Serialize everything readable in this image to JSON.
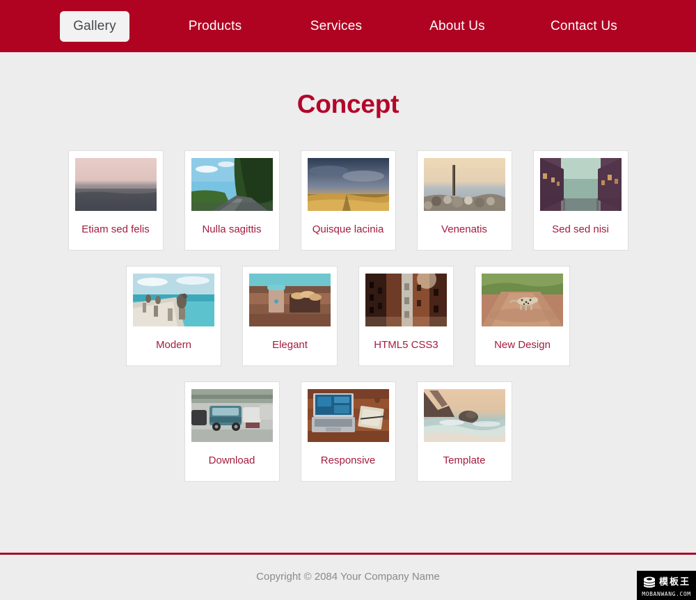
{
  "nav": {
    "items": [
      {
        "label": "Gallery",
        "active": true
      },
      {
        "label": "Products",
        "active": false
      },
      {
        "label": "Services",
        "active": false
      },
      {
        "label": "About Us",
        "active": false
      },
      {
        "label": "Contact Us",
        "active": false
      }
    ],
    "background_color": "#b00322",
    "active_background_color": "#f2f2f2",
    "active_text_color": "#444a4d",
    "text_color": "#ffffff"
  },
  "main": {
    "title": "Concept",
    "title_color": "#b3062a",
    "background_color": "#ededed",
    "gallery": {
      "label_color": "#a31c3e",
      "rows": [
        {
          "items": [
            {
              "label": "Etiam sed felis",
              "image": "seascape-pink-horizon"
            },
            {
              "label": "Nulla sagittis",
              "image": "coastal-cliff-road"
            },
            {
              "label": "Quisque lacinia",
              "image": "golden-field-dusk"
            },
            {
              "label": "Venenatis",
              "image": "wooden-post-rocks-sea"
            },
            {
              "label": "Sed sed nisi",
              "image": "canal-city-purple"
            }
          ]
        },
        {
          "items": [
            {
              "label": "Modern",
              "image": "pelicans-on-pier"
            },
            {
              "label": "Elegant",
              "image": "coffee-cup-pastries"
            },
            {
              "label": "HTML5 CSS3",
              "image": "rusty-building-facade"
            },
            {
              "label": "New Design",
              "image": "leopard-dirt-road"
            }
          ]
        },
        {
          "items": [
            {
              "label": "Download",
              "image": "vintage-van-street"
            },
            {
              "label": "Responsive",
              "image": "laptop-desk-notebook"
            },
            {
              "label": "Template",
              "image": "rocky-beach-waves"
            }
          ]
        }
      ]
    }
  },
  "footer": {
    "divider_color": "#9b1131",
    "copyright": "Copyright © 2084 Your Company Name",
    "copyright_color": "#8a8a8a"
  },
  "watermark": {
    "chinese_text": "模板王",
    "url_text": "MOBANWANG.COM",
    "icon": "stacked-books-icon",
    "background_color": "#000000"
  }
}
